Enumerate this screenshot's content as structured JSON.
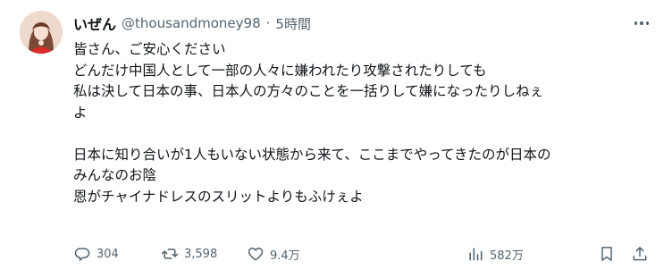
{
  "tweet": {
    "display_name": "いぜん",
    "handle": "@thousandmoney98",
    "separator": "·",
    "time": "5時間",
    "lines": [
      "皆さん、ご安心ください",
      "どんだけ中国人として一部の人々に嫌われたり攻撃されたりしても",
      "私は決して日本の事、日本人の方々のことを一括りして嫌になったりしねぇ",
      "よ",
      "",
      "日本に知り合いが1人もいない状態から来て、ここまでやってきたのが日本の",
      "みんなのお陰",
      "恩がチャイナドレスのスリットよりもふけぇよ"
    ]
  },
  "actions": {
    "replies": "304",
    "reposts": "3,598",
    "likes": "9.4万",
    "views": "582万"
  },
  "icons": {
    "reply": "reply-icon",
    "repost": "repost-icon",
    "like": "heart-icon",
    "views": "views-chart-icon",
    "bookmark": "bookmark-icon",
    "share": "share-icon",
    "more": "more-icon"
  },
  "colors": {
    "text": "#0f1419",
    "secondary": "#536471"
  }
}
